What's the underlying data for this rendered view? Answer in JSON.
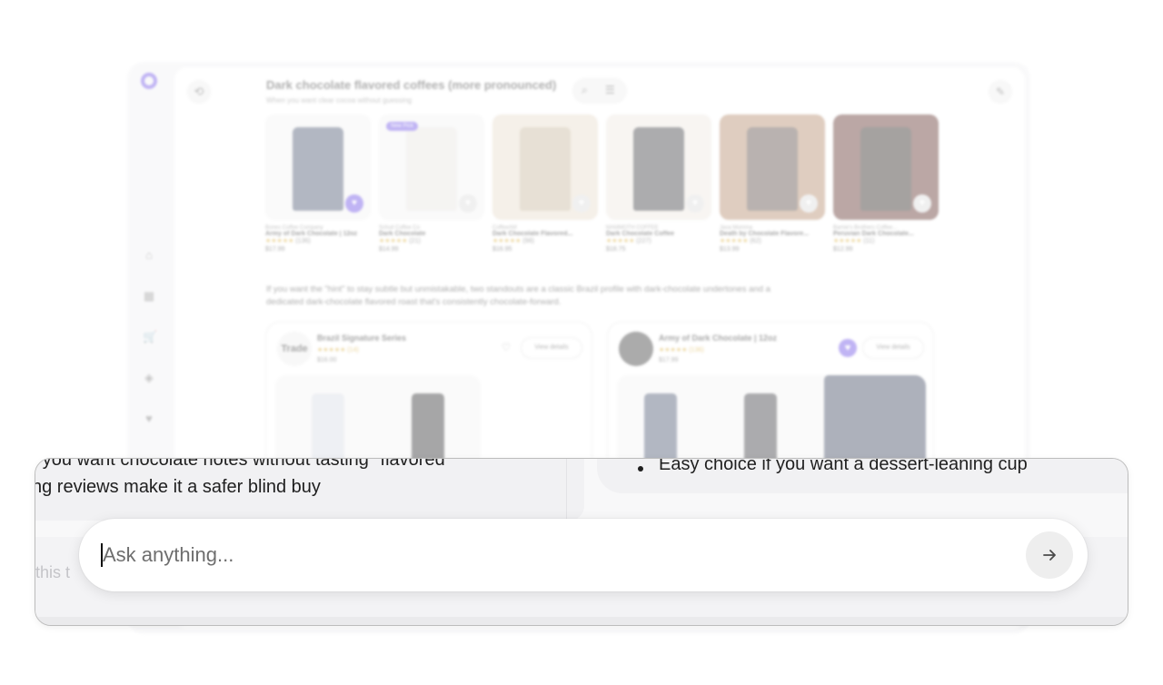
{
  "background": {
    "section_title": "Dark chocolate flavored coffees (more pronounced)",
    "section_subtitle": "When you want clear cocoa without guessing",
    "products": [
      {
        "brand": "Bones Coffee Company",
        "name": "Army of Dark Chocolate | 12oz",
        "reviews": "(136)",
        "price": "$17.99",
        "favorited": true,
        "badge": "",
        "img_color": "#f4f4f4",
        "bag_color": "#4a5670"
      },
      {
        "brand": "Schuil Coffee Co",
        "name": "Dark Chocolate",
        "reviews": "(21)",
        "price": "$14.99",
        "favorited": false,
        "badge": "New Pick",
        "img_color": "#f4f4f4",
        "bag_color": "#e9e6e2"
      },
      {
        "brand": "CoffeeAM",
        "name": "Dark Chocolate Flavored...",
        "reviews": "(98)",
        "price": "$16.95",
        "favorited": false,
        "badge": "",
        "img_color": "#e8dccb",
        "bag_color": "#c7b79c"
      },
      {
        "brand": "MAMMOTH COFFEE",
        "name": "Dark Chocolate Coffee",
        "reviews": "(227)",
        "price": "$18.75",
        "favorited": false,
        "badge": "",
        "img_color": "#efe9e2",
        "bag_color": "#3b3b40"
      },
      {
        "brand": "Java Momma",
        "name": "Death by Chocolate Flavore...",
        "reviews": "(62)",
        "price": "$13.99",
        "favorited": false,
        "badge": "",
        "img_color": "#b58a6a",
        "bag_color": "#5b4a44"
      },
      {
        "brand": "Barnie's Brothers Coffee...",
        "name": "Peruvian Dark Chocolate...",
        "reviews": "(11)",
        "price": "$12.99",
        "favorited": false,
        "badge": "",
        "img_color": "#5e2f2a",
        "bag_color": "#2b2420"
      }
    ],
    "paragraph": "If you want the \"hint\" to stay subtle but unmistakable, two standouts are a classic Brazil profile with dark-chocolate undertones and a dedicated dark-chocolate flavored roast that's consistently chocolate-forward.",
    "cards": [
      {
        "logo_text": "Trade",
        "name": "Brazil Signature Series",
        "reviews": "(14)",
        "price": "$16.00",
        "favorited": false,
        "view_label": "View details"
      },
      {
        "logo_text": "",
        "name": "Army of Dark Chocolate | 12oz",
        "reviews": "(136)",
        "price": "$17.99",
        "favorited": true,
        "view_label": "View details"
      }
    ],
    "star_glyphs": "★★★★★"
  },
  "zoom": {
    "left_line1": "...f you want chocolate notes without tasting \"flavored\"",
    "left_line2": "ng reviews make it a safer blind buy",
    "right_bullet": "Easy choice if you want a dessert-leaning cup",
    "ghost_text": "t this t",
    "input_placeholder": "Ask anything...",
    "send_icon": "arrow-right-icon"
  },
  "colors": {
    "accent": "#6b4ee6"
  }
}
